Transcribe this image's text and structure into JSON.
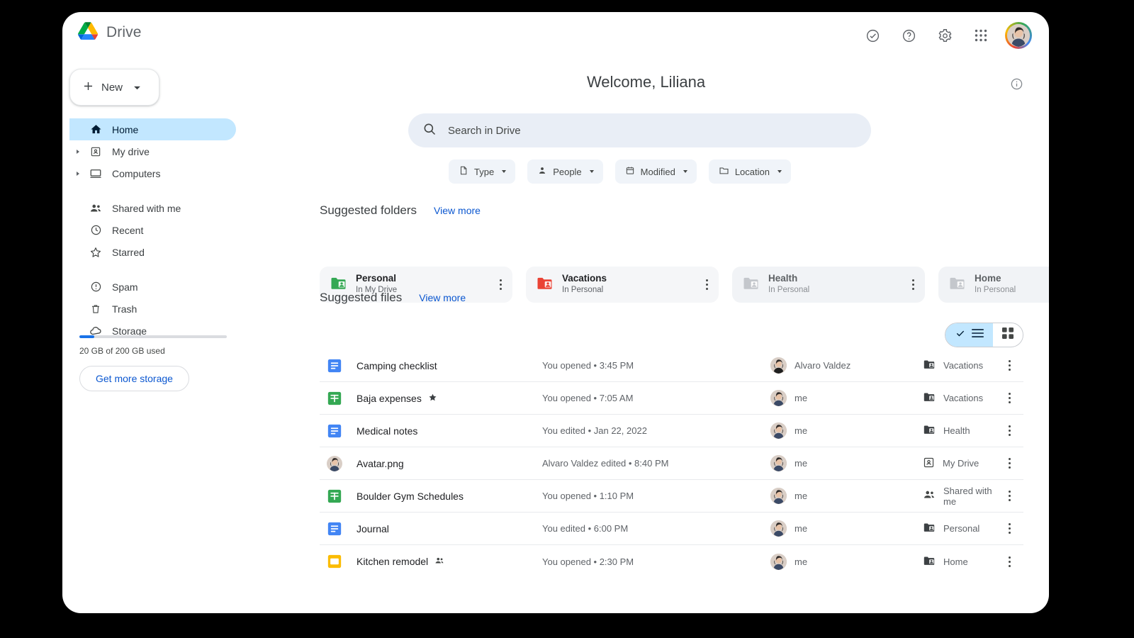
{
  "app": {
    "name": "Drive",
    "logo_icon": "google-drive-logo"
  },
  "topbar": {
    "icons": [
      {
        "name": "activity-icon",
        "label": "Activity"
      },
      {
        "name": "help-icon",
        "label": "Support"
      },
      {
        "name": "gear-icon",
        "label": "Settings"
      },
      {
        "name": "apps-grid-icon",
        "label": "Google apps"
      }
    ],
    "avatar_name": "account-avatar"
  },
  "sidebar": {
    "new_button": {
      "label": "New",
      "plus_icon": "plus-icon",
      "caret_icon": "chevron-down-icon"
    },
    "items": [
      {
        "label": "Home",
        "icon": "home-icon",
        "active": true,
        "expandable": false
      },
      {
        "label": "My drive",
        "icon": "my-drive-icon",
        "active": false,
        "expandable": true
      },
      {
        "label": "Computers",
        "icon": "computer-icon",
        "active": false,
        "expandable": true
      },
      {
        "label": "Shared with me",
        "icon": "people-icon",
        "active": false,
        "expandable": false
      },
      {
        "label": "Recent",
        "icon": "clock-icon",
        "active": false,
        "expandable": false
      },
      {
        "label": "Starred",
        "icon": "star-icon",
        "active": false,
        "expandable": false
      },
      {
        "label": "Spam",
        "icon": "spam-icon",
        "active": false,
        "expandable": false
      },
      {
        "label": "Trash",
        "icon": "trash-icon",
        "active": false,
        "expandable": false
      },
      {
        "label": "Storage",
        "icon": "cloud-icon",
        "active": false,
        "expandable": false
      }
    ],
    "storage": {
      "used_percent": 10,
      "text": "20 GB of 200 GB used",
      "cta_label": "Get more storage",
      "bar_color": "#1a73e8"
    }
  },
  "main": {
    "welcome_title": "Welcome, Liliana",
    "info_icon": "info-icon",
    "search": {
      "placeholder": "Search in Drive",
      "value": "",
      "icon": "search-icon"
    },
    "filter_chips": [
      {
        "label": "Type",
        "icon": "file-icon"
      },
      {
        "label": "People",
        "icon": "person-icon"
      },
      {
        "label": "Modified",
        "icon": "calendar-icon"
      },
      {
        "label": "Location",
        "icon": "folder-icon"
      }
    ],
    "suggested_folders": {
      "title": "Suggested folders",
      "view_more": "View more",
      "items": [
        {
          "name": "Personal",
          "location": "In My Drive",
          "color": "#34a853",
          "faded": false,
          "icon": "shared-folder-icon",
          "menu_icon": "kebab-menu-icon"
        },
        {
          "name": "Vacations",
          "location": "In Personal",
          "color": "#ea4335",
          "faded": false,
          "icon": "shared-folder-icon",
          "menu_icon": "kebab-menu-icon"
        },
        {
          "name": "Health",
          "location": "In Personal",
          "color": "#c4c7cc",
          "faded": true,
          "icon": "shared-folder-icon",
          "menu_icon": "kebab-menu-icon"
        },
        {
          "name": "Home",
          "location": "In Personal",
          "color": "#c4c7cc",
          "faded": true,
          "icon": "shared-folder-icon",
          "menu_icon": "kebab-menu-icon"
        }
      ]
    },
    "suggested_files": {
      "title": "Suggested files",
      "view_more": "View more",
      "view_toggle": {
        "list_selected": true,
        "check_icon": "check-icon",
        "list_icon": "list-view-icon",
        "grid_icon": "grid-view-icon"
      },
      "rows": [
        {
          "name": "Camping checklist",
          "file_type": "docs",
          "starred": false,
          "shared": false,
          "activity": "You opened • 3:45 PM",
          "owner": "Alvaro Valdez",
          "owner_avatar": "avatar-alvaro",
          "location": "Vacations",
          "location_icon": "shared-folder-icon",
          "menu_icon": "kebab-menu-icon"
        },
        {
          "name": "Baja expenses",
          "file_type": "sheets",
          "starred": true,
          "shared": false,
          "activity": "You opened • 7:05 AM",
          "owner": "me",
          "owner_avatar": "avatar-me",
          "location": "Vacations",
          "location_icon": "shared-folder-icon",
          "menu_icon": "kebab-menu-icon"
        },
        {
          "name": "Medical notes",
          "file_type": "docs",
          "starred": false,
          "shared": false,
          "activity": "You edited • Jan 22, 2022",
          "owner": "me",
          "owner_avatar": "avatar-me",
          "location": "Health",
          "location_icon": "shared-folder-icon",
          "menu_icon": "kebab-menu-icon"
        },
        {
          "name": "Avatar.png",
          "file_type": "image",
          "starred": false,
          "shared": false,
          "activity": "Alvaro Valdez edited • 8:40 PM",
          "owner": "me",
          "owner_avatar": "avatar-me",
          "location": "My Drive",
          "location_icon": "my-drive-icon",
          "menu_icon": "kebab-menu-icon"
        },
        {
          "name": "Boulder Gym Schedules",
          "file_type": "sheets",
          "starred": false,
          "shared": false,
          "activity": "You opened • 1:10 PM",
          "owner": "me",
          "owner_avatar": "avatar-me",
          "location": "Shared with me",
          "location_icon": "people-icon",
          "menu_icon": "kebab-menu-icon"
        },
        {
          "name": "Journal",
          "file_type": "docs",
          "starred": false,
          "shared": false,
          "activity": "You edited • 6:00 PM",
          "owner": "me",
          "owner_avatar": "avatar-me",
          "location": "Personal",
          "location_icon": "shared-folder-icon",
          "menu_icon": "kebab-menu-icon"
        },
        {
          "name": "Kitchen remodel",
          "file_type": "slides",
          "starred": false,
          "shared": true,
          "activity": "You opened • 2:30 PM",
          "owner": "me",
          "owner_avatar": "avatar-me",
          "location": "Home",
          "location_icon": "shared-folder-icon",
          "menu_icon": "kebab-menu-icon"
        }
      ]
    }
  },
  "colors": {
    "accent_blue": "#0b57d0",
    "selected_chip": "#c2e7ff",
    "docs": "#4285f4",
    "sheets": "#34a853",
    "slides": "#fbbc04"
  }
}
